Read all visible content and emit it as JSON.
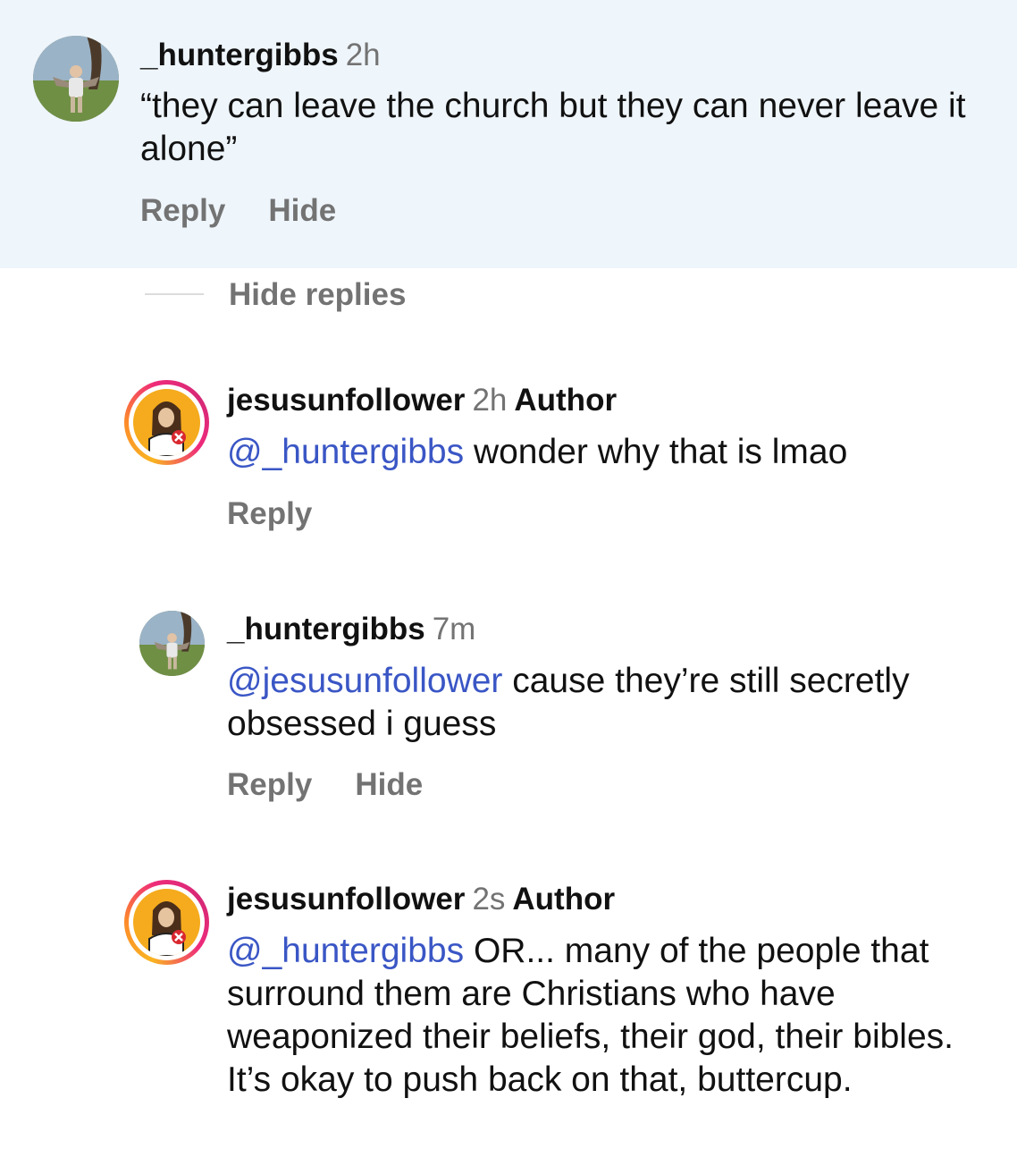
{
  "comments": [
    {
      "username": "_huntergibbs",
      "time": "2h",
      "author_badge": "",
      "mention": "",
      "text": "“they can leave the church but they can never leave it alone”",
      "actions": [
        "Reply",
        "Hide"
      ]
    },
    {
      "username": "jesusunfollower",
      "time": "2h",
      "author_badge": "Author",
      "mention": "@_huntergibbs",
      "text": " wonder why that is lmao",
      "actions": [
        "Reply"
      ]
    },
    {
      "username": "_huntergibbs",
      "time": "7m",
      "author_badge": "",
      "mention": "@jesusunfollower",
      "text": " cause they’re still secretly obsessed i guess",
      "actions": [
        "Reply",
        "Hide"
      ]
    },
    {
      "username": "jesusunfollower",
      "time": "2s",
      "author_badge": "Author",
      "mention": "@_huntergibbs",
      "text": " OR... many of the people that surround them are Christians who have weaponized their beliefs, their god, their bibles. It’s okay to push back on that, buttercup.",
      "actions": []
    }
  ],
  "hide_replies_label": "Hide replies",
  "colors": {
    "highlight_bg": "#eef5fb",
    "mention": "#3a56c5",
    "muted": "#737373"
  },
  "icons": {
    "photo_avatar": "person-photo-avatar",
    "story_avatar": "jesus-unfollow-avatar"
  }
}
